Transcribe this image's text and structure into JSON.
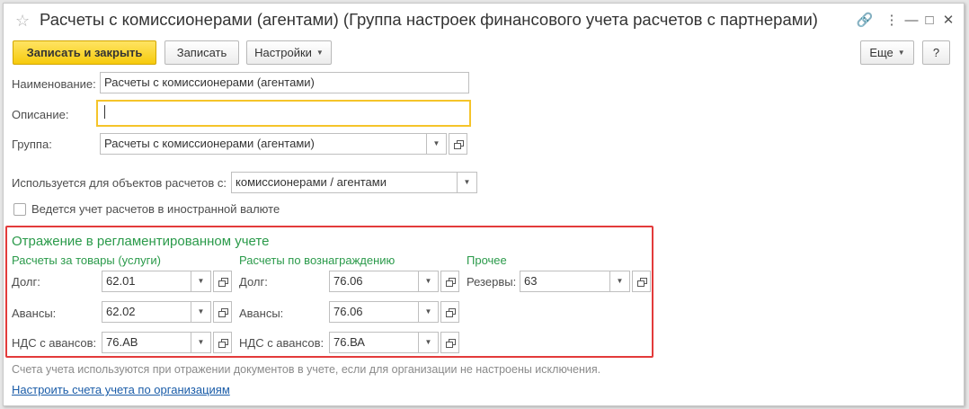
{
  "window": {
    "title": "Расчеты с комиссионерами (агентами) (Группа настроек финансового учета расчетов с партнерами)",
    "controls": {
      "link": "🔗",
      "more": "⋮",
      "minimize": "—",
      "maximize": "□",
      "close": "✕"
    }
  },
  "toolbar": {
    "save_close": "Записать и закрыть",
    "save": "Записать",
    "settings": "Настройки",
    "more": "Еще",
    "help": "?"
  },
  "form": {
    "name_label": "Наименование:",
    "name_value": "Расчеты с комиссионерами (агентами)",
    "desc_label": "Описание:",
    "desc_value": "",
    "group_label": "Группа:",
    "group_value": "Расчеты с комиссионерами (агентами)",
    "used_label": "Используется для объектов расчетов с:",
    "used_value": "комиссионерами / агентами",
    "currency_checkbox_label": "Ведется учет расчетов в иностранной валюте",
    "currency_checked": false
  },
  "accounting": {
    "title": "Отражение в регламентированном учете",
    "goods": {
      "title": "Расчеты за товары (услуги)",
      "debt_label": "Долг:",
      "debt_value": "62.01",
      "advances_label": "Авансы:",
      "advances_value": "62.02",
      "vat_label": "НДС с авансов:",
      "vat_value": "76.АВ"
    },
    "reward": {
      "title": "Расчеты по вознаграждению",
      "debt_label": "Долг:",
      "debt_value": "76.06",
      "advances_label": "Авансы:",
      "advances_value": "76.06",
      "vat_label": "НДС с авансов:",
      "vat_value": "76.ВА"
    },
    "other": {
      "title": "Прочее",
      "reserves_label": "Резервы:",
      "reserves_value": "63"
    }
  },
  "footer": {
    "note": "Счета учета используются при отражении документов в учете, если для организации не настроены исключения.",
    "link": "Настроить счета учета по организациям"
  },
  "colors": {
    "accent_green": "#2a9a4a",
    "primary_button": "#f6ca0c",
    "highlight_border": "#e33b3b",
    "focus_border": "#f5c42a",
    "link": "#1a5ca8"
  }
}
